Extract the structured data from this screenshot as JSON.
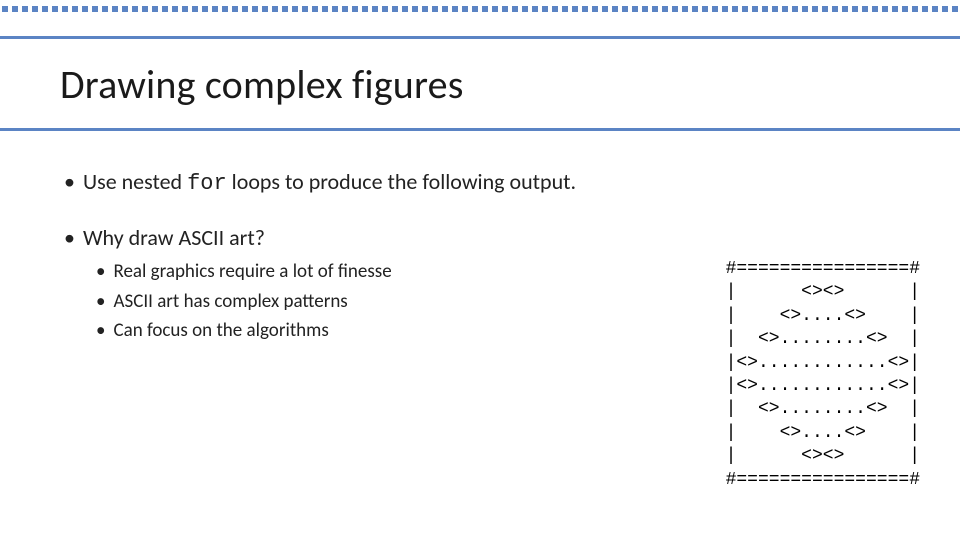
{
  "title": "Drawing complex figures",
  "bullet1a_prefix": "Use nested ",
  "bullet1a_code": "for",
  "bullet1a_suffix": " loops to produce the following output.",
  "bullet1b": "Why draw ASCII art?",
  "sub": {
    "a": "Real graphics require a lot of finesse",
    "b": "ASCII art has complex patterns",
    "c": "Can focus on the algorithms"
  },
  "ascii": "#================#\n|      <><>      |\n|    <>....<>    |\n|  <>........<>  |\n|<>............<>|\n|<>............<>|\n|  <>........<>  |\n|    <>....<>    |\n|      <><>      |\n#================#"
}
